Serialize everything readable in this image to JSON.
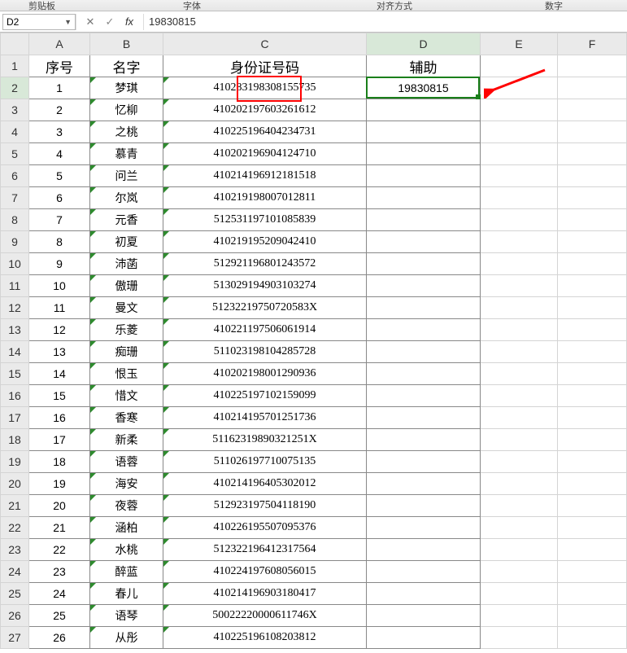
{
  "ribbon_groups": {
    "clipboard": "剪贴板",
    "font": "字体",
    "align": "对齐方式",
    "number": "数字"
  },
  "namebox": "D2",
  "fx_glyph_cancel": "✕",
  "fx_glyph_confirm": "✓",
  "fx_glyph_fx": "fx",
  "formula_value": "19830815",
  "col_labels": [
    "A",
    "B",
    "C",
    "D",
    "E",
    "F"
  ],
  "row_count": 27,
  "headers": {
    "A": "序号",
    "B": "名字",
    "C": "身份证号码",
    "D": "辅助"
  },
  "selected_cell": "D2",
  "d2_value": "19830815",
  "rows": [
    {
      "n": "1",
      "name": "梦琪",
      "id": "410283198308155735"
    },
    {
      "n": "2",
      "name": "忆柳",
      "id": "410202197603261612"
    },
    {
      "n": "3",
      "name": "之桃",
      "id": "410225196404234731"
    },
    {
      "n": "4",
      "name": "慕青",
      "id": "410202196904124710"
    },
    {
      "n": "5",
      "name": "问兰",
      "id": "410214196912181518"
    },
    {
      "n": "6",
      "name": "尔岚",
      "id": "410219198007012811"
    },
    {
      "n": "7",
      "name": "元香",
      "id": "512531197101085839"
    },
    {
      "n": "8",
      "name": "初夏",
      "id": "410219195209042410"
    },
    {
      "n": "9",
      "name": "沛菡",
      "id": "512921196801243572"
    },
    {
      "n": "10",
      "name": "傲珊",
      "id": "513029194903103274"
    },
    {
      "n": "11",
      "name": "曼文",
      "id": "51232219750720583X"
    },
    {
      "n": "12",
      "name": "乐菱",
      "id": "410221197506061914"
    },
    {
      "n": "13",
      "name": "痴珊",
      "id": "511023198104285728"
    },
    {
      "n": "14",
      "name": "恨玉",
      "id": "410202198001290936"
    },
    {
      "n": "15",
      "name": "惜文",
      "id": "410225197102159099"
    },
    {
      "n": "16",
      "name": "香寒",
      "id": "410214195701251736"
    },
    {
      "n": "17",
      "name": "新柔",
      "id": "51162319890321251X"
    },
    {
      "n": "18",
      "name": "语蓉",
      "id": "511026197710075135"
    },
    {
      "n": "19",
      "name": "海安",
      "id": "410214196405302012"
    },
    {
      "n": "20",
      "name": "夜蓉",
      "id": "512923197504118190"
    },
    {
      "n": "21",
      "name": "涵柏",
      "id": "410226195507095376"
    },
    {
      "n": "22",
      "name": "水桃",
      "id": "512322196412317564"
    },
    {
      "n": "23",
      "name": "醉蓝",
      "id": "410224197608056015"
    },
    {
      "n": "24",
      "name": "春儿",
      "id": "410214196903180417"
    },
    {
      "n": "25",
      "name": "语琴",
      "id": "50022220000611746X"
    },
    {
      "n": "26",
      "name": "从彤",
      "id": "410225196108203812"
    }
  ]
}
